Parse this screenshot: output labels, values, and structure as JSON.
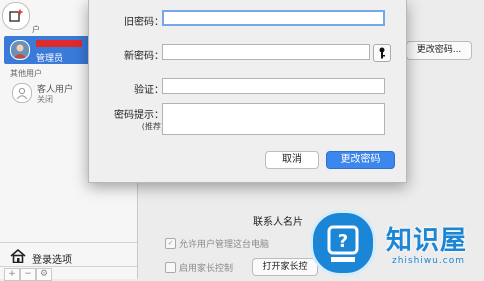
{
  "sidebar": {
    "current_user_section": "户",
    "admin_role": "管理员",
    "other_users_section": "其他用户",
    "guest_name": "客人用户",
    "guest_status": "关闭",
    "login_options": "登录选项",
    "add_label": "+",
    "remove_label": "−"
  },
  "dialog": {
    "old_password_label": "旧密码：",
    "new_password_label": "新密码：",
    "verify_label": "验证：",
    "hint_label": "密码提示：",
    "hint_sublabel": "(推荐)",
    "cancel_label": "取消",
    "change_label": "更改密码"
  },
  "main": {
    "change_password_button": "更改密码...",
    "contacts_card_label": "联系人名片",
    "allow_admin_label": "允许用户管理这台电脑",
    "parental_controls_label": "启用家长控制",
    "open_parental_button": "打开家长控"
  },
  "watermark": {
    "text": "知识屋",
    "url": "zhishiwu.com"
  },
  "colors": {
    "accent": "#3d86ec",
    "selection": "#3a7ad9",
    "watermark": "#1b86d6"
  }
}
